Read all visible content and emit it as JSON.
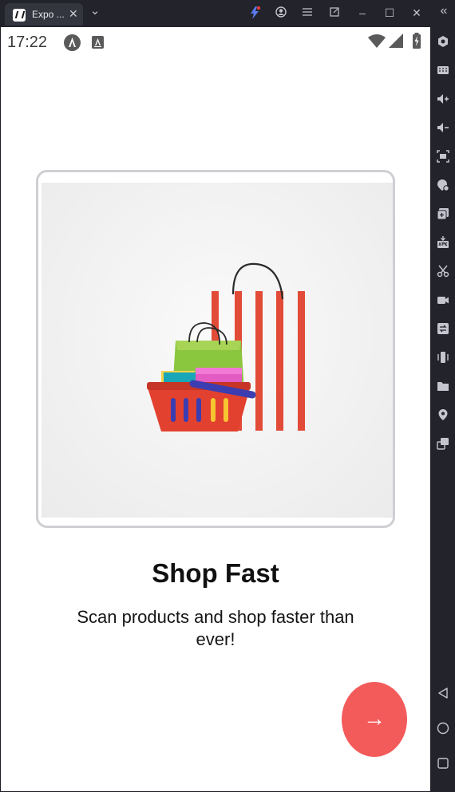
{
  "window": {
    "tab_title": "Expo ...",
    "tab_close_glyph": "✕",
    "dropdown_glyph": "⌄",
    "controls": {
      "minimize": "–",
      "maximize": "☐",
      "close": "✕",
      "collapse": "«"
    }
  },
  "status_bar": {
    "time": "17:22",
    "icons": [
      "notification-a-icon",
      "font-icon",
      "wifi-icon",
      "signal-icon",
      "battery-icon"
    ]
  },
  "onboarding": {
    "image_alt": "shopping-basket-illustration",
    "title": "Shop Fast",
    "subtitle": "Scan products and shop faster than ever!",
    "next_button_glyph": "→"
  },
  "sidebar": {
    "tools": [
      "settings-icon",
      "keyboard-icon",
      "volume-up-icon",
      "volume-down-icon",
      "screenshot-icon",
      "location-lock-icon",
      "add-window-icon",
      "apk-install-icon",
      "cut-icon",
      "video-record-icon",
      "sync-icon",
      "shake-icon",
      "folder-icon",
      "location-icon",
      "multi-window-icon",
      "back-icon",
      "home-icon",
      "recents-icon"
    ]
  },
  "colors": {
    "accent": "#f35b5b",
    "card_border": "#cfcfd3",
    "chrome": "#22232b"
  }
}
